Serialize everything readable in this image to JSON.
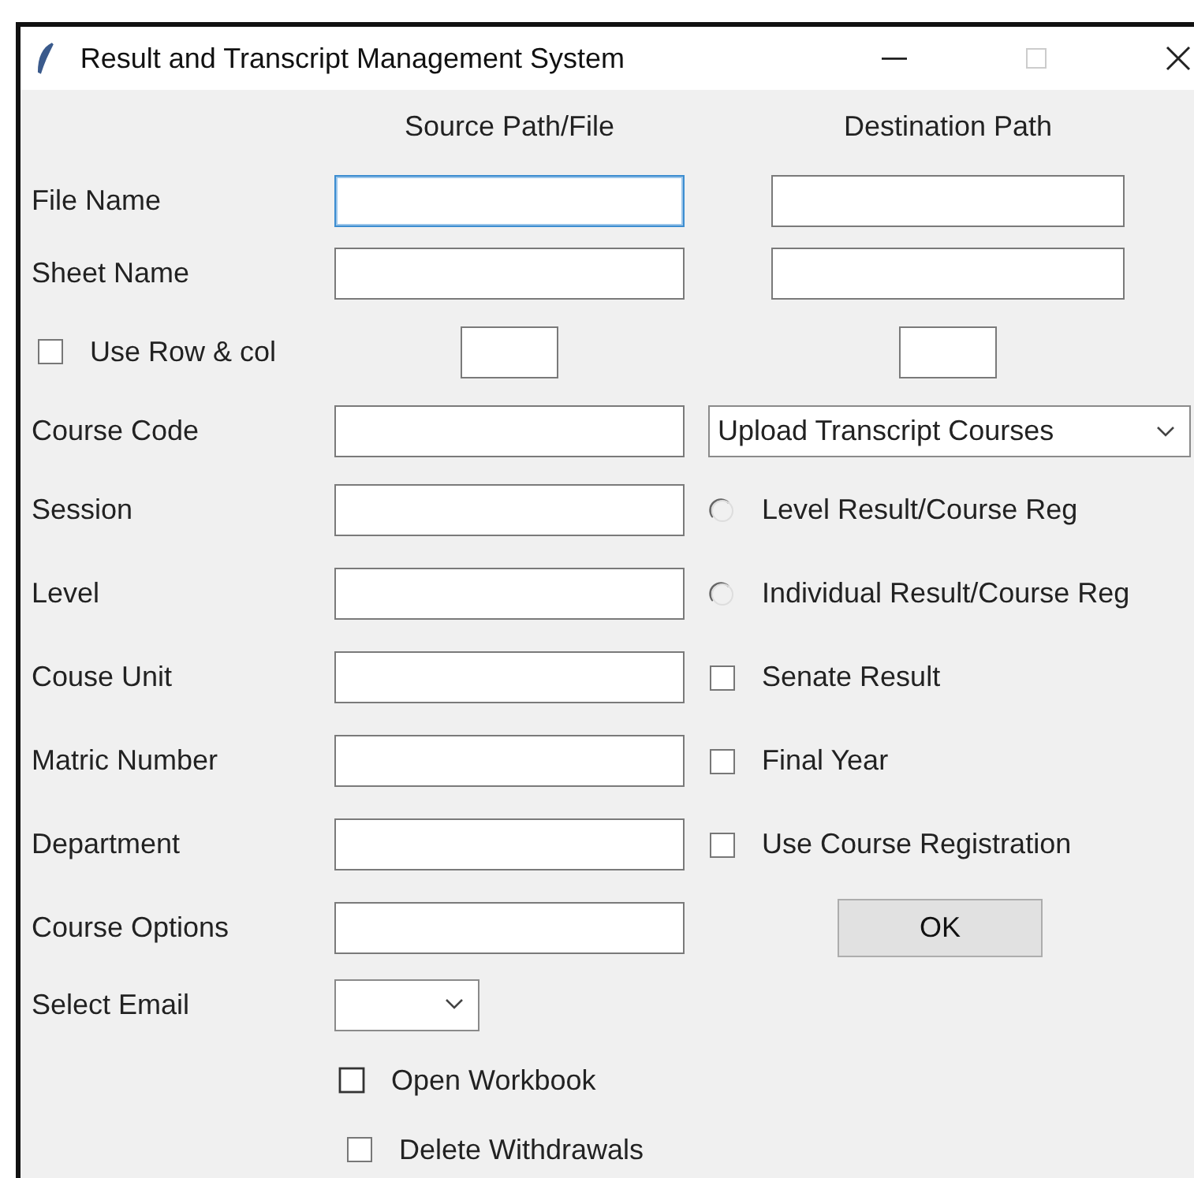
{
  "window": {
    "title": "Result and Transcript Management System",
    "maximize_disabled": true
  },
  "headers": [
    "Source Path/File",
    "Destination Path"
  ],
  "path_rows": [
    {
      "label": "File Name",
      "source": {
        "focused": true
      },
      "destination": {
        "focused": false
      }
    },
    {
      "label": "Sheet Name",
      "source": {
        "focused": false
      },
      "destination": {
        "focused": false
      }
    }
  ],
  "use_row_col": {
    "label": "Use Row & col",
    "checked": false
  },
  "form_rows": [
    {
      "label": "Course Code",
      "right": {
        "kind": "dropdown",
        "value": "Upload Transcript Courses"
      }
    },
    {
      "label": "Session",
      "right": {
        "kind": "radio",
        "label": "Level Result/Course Reg",
        "selected": false
      }
    },
    {
      "label": "Level",
      "right": {
        "kind": "radio",
        "label": "Individual Result/Course Reg",
        "selected": false
      }
    },
    {
      "label": "Couse Unit",
      "right": {
        "kind": "checkbox",
        "label": "Senate Result",
        "checked": false
      }
    },
    {
      "label": "Matric Number",
      "right": {
        "kind": "checkbox",
        "label": "Final Year",
        "checked": false
      }
    },
    {
      "label": "Department",
      "right": {
        "kind": "checkbox",
        "label": "Use Course Registration",
        "checked": false
      }
    },
    {
      "label": "Course Options",
      "right": {
        "kind": "button",
        "label": "OK"
      }
    }
  ],
  "select_email": {
    "label": "Select Email"
  },
  "bottom_checks": [
    {
      "label": "Open Workbook",
      "checked": false
    },
    {
      "label": "Delete Withdrawals",
      "checked": false
    }
  ]
}
